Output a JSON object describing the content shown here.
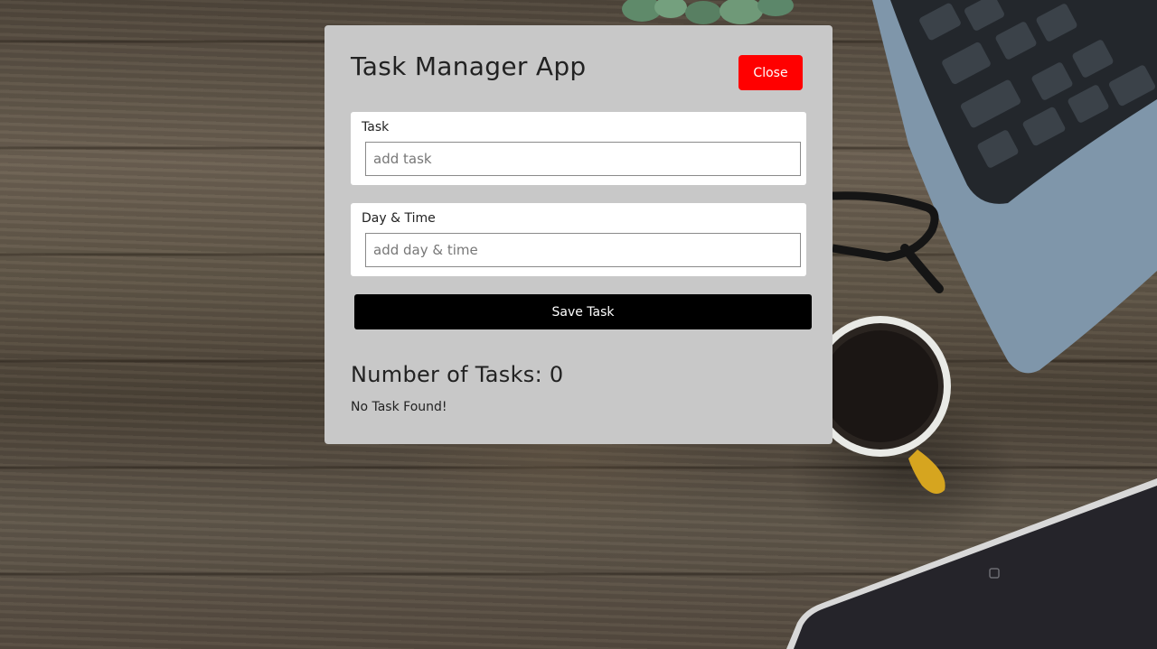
{
  "app": {
    "title": "Task Manager App",
    "close_label": "Close"
  },
  "form": {
    "task": {
      "label": "Task",
      "placeholder": "add task",
      "value": ""
    },
    "day_time": {
      "label": "Day & Time",
      "placeholder": "add day & time",
      "value": ""
    },
    "save_label": "Save Task"
  },
  "tasks": {
    "count_label": "Number of Tasks: 0",
    "empty_message": "No Task Found!"
  },
  "colors": {
    "card_background": "#c8c8c8",
    "close_button": "#ff0000",
    "save_button": "#000000"
  },
  "background": {
    "description_icons": [
      "plant",
      "laptop-keyboard",
      "glasses",
      "coffee-cup",
      "tablet"
    ]
  }
}
